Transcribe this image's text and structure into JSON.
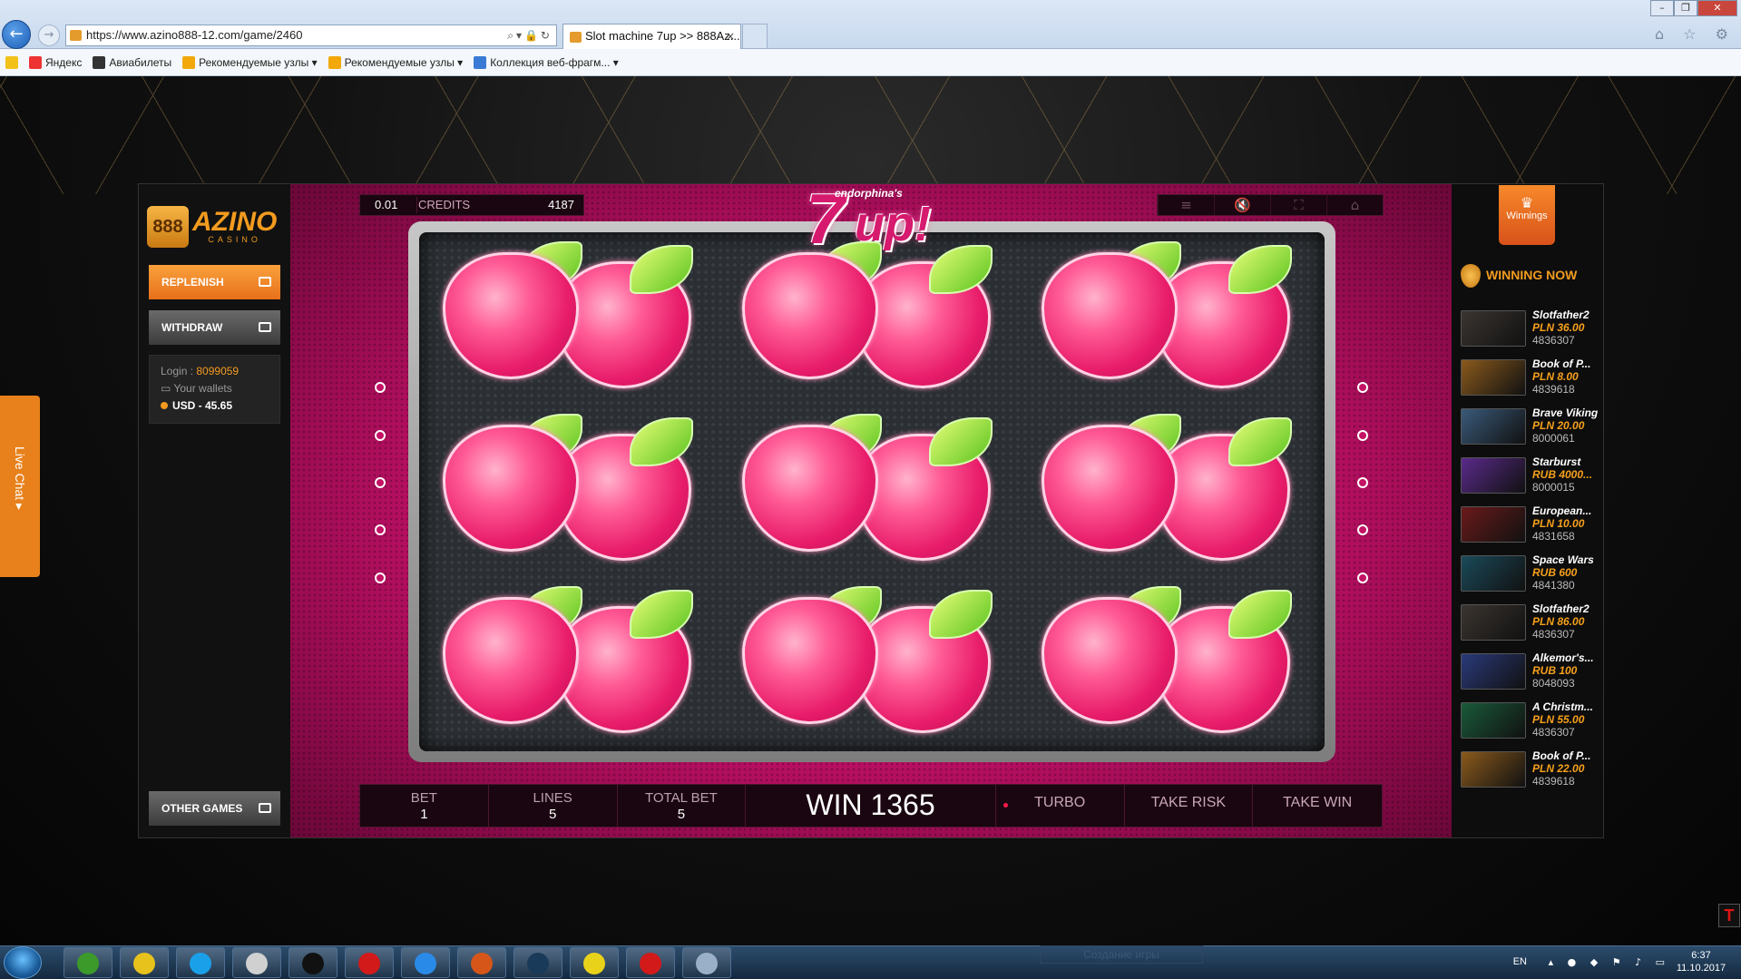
{
  "browser": {
    "url": "https://www.azino888-12.com/game/2460",
    "tab_title": "Slot machine 7up >> 888Az...",
    "tab_close": "×",
    "favorites": [
      {
        "label": "Яндекс",
        "color": "#e33"
      },
      {
        "label": "Авиабилеты",
        "color": "#333"
      },
      {
        "label": "Рекомендуемые узлы ▾",
        "color": "#f2a80a"
      },
      {
        "label": "Рекомендуемые узлы ▾",
        "color": "#f2a80a"
      },
      {
        "label": "Коллекция веб-фрагм... ▾",
        "color": "#3a7bd5"
      }
    ],
    "win_controls": [
      "–",
      "❐",
      "✕"
    ],
    "right_icons": "⌂ ☆ ⚙"
  },
  "casino": {
    "logo_mark": "888",
    "logo_text": "AZINO",
    "logo_sub": "CASINO",
    "replenish_label": "REPLENISH",
    "withdraw_label": "WITHDRAW",
    "login_label": "Login : ",
    "login_value": "8099059",
    "wallets_label": "Your wallets",
    "balance": "USD - 45.65",
    "other_games_label": "OTHER GAMES",
    "live_chat_label": "Live Chat ▸"
  },
  "game": {
    "bet_value": "0.01",
    "credits_label": "CREDITS",
    "credits_value": "4187",
    "title_endorphina": "endorphina's",
    "title_seven": "7",
    "title_up": "up!",
    "toolbar_icons": [
      "≡",
      "🔇",
      "⛶",
      "⌂"
    ],
    "bottom": {
      "bet_label": "BET",
      "bet_value": "1",
      "lines_label": "LINES",
      "lines_value": "5",
      "total_label": "TOTAL BET",
      "total_value": "5",
      "win_text": "WIN 1365",
      "turbo_label": "TURBO",
      "take_risk_label": "TAKE RISK",
      "take_win_label": "TAKE WIN"
    },
    "reels": [
      [
        "raspberry",
        "raspberry",
        "raspberry"
      ],
      [
        "raspberry",
        "raspberry",
        "raspberry"
      ],
      [
        "raspberry",
        "raspberry",
        "raspberry"
      ]
    ]
  },
  "winners": {
    "tab_label": "Winnings",
    "tab_icon": "♛",
    "heading": "WINNING NOW",
    "items": [
      {
        "name": "Slotfather2",
        "amount": "PLN 36.00",
        "id": "4836307",
        "color": "#3b3530"
      },
      {
        "name": "Book of P...",
        "amount": "PLN 8.00",
        "id": "4839618",
        "color": "#8a5a1c"
      },
      {
        "name": "Brave Viking",
        "amount": "PLN 20.00",
        "id": "8000061",
        "color": "#3a5a7a"
      },
      {
        "name": "Starburst",
        "amount": "RUB 4000...",
        "id": "8000015",
        "color": "#5a2a8a"
      },
      {
        "name": "European...",
        "amount": "PLN 10.00",
        "id": "4831658",
        "color": "#6a1a1a"
      },
      {
        "name": "Space Wars",
        "amount": "RUB 600",
        "id": "4841380",
        "color": "#1a4a5a"
      },
      {
        "name": "Slotfather2",
        "amount": "PLN 86.00",
        "id": "4836307",
        "color": "#3b3530"
      },
      {
        "name": "Alkemor's...",
        "amount": "RUB 100",
        "id": "8048093",
        "color": "#2a3a7a"
      },
      {
        "name": "A Christm...",
        "amount": "PLN 55.00",
        "id": "4836307",
        "color": "#1a5a3a"
      },
      {
        "name": "Book of P...",
        "amount": "PLN 22.00",
        "id": "4839618",
        "color": "#8a5a1c"
      }
    ]
  },
  "taskbar": {
    "lang": "EN",
    "tray_icons": "▴ ● ◆ ⚑ ♪ ▭",
    "time": "6:37",
    "date": "11.10.2017",
    "ghost_button": "Создание игры",
    "apps": [
      {
        "name": "cards-app",
        "color": "#3c9a2a"
      },
      {
        "name": "chrome",
        "color": "#e8c21c"
      },
      {
        "name": "skype",
        "color": "#1aa0e8"
      },
      {
        "name": "avatar-app",
        "color": "#d0d0d0"
      },
      {
        "name": "ti-app",
        "color": "#111"
      },
      {
        "name": "pokerstars",
        "color": "#d21a1a"
      },
      {
        "name": "ie",
        "color": "#2a8ae8"
      },
      {
        "name": "game-launcher",
        "color": "#d6561a"
      },
      {
        "name": "steam",
        "color": "#1a3a5a"
      },
      {
        "name": "vegas-app",
        "color": "#e8d21a"
      },
      {
        "name": "app-2",
        "color": "#d21a1a"
      },
      {
        "name": "calculator",
        "color": "#9ab0c8"
      }
    ]
  }
}
